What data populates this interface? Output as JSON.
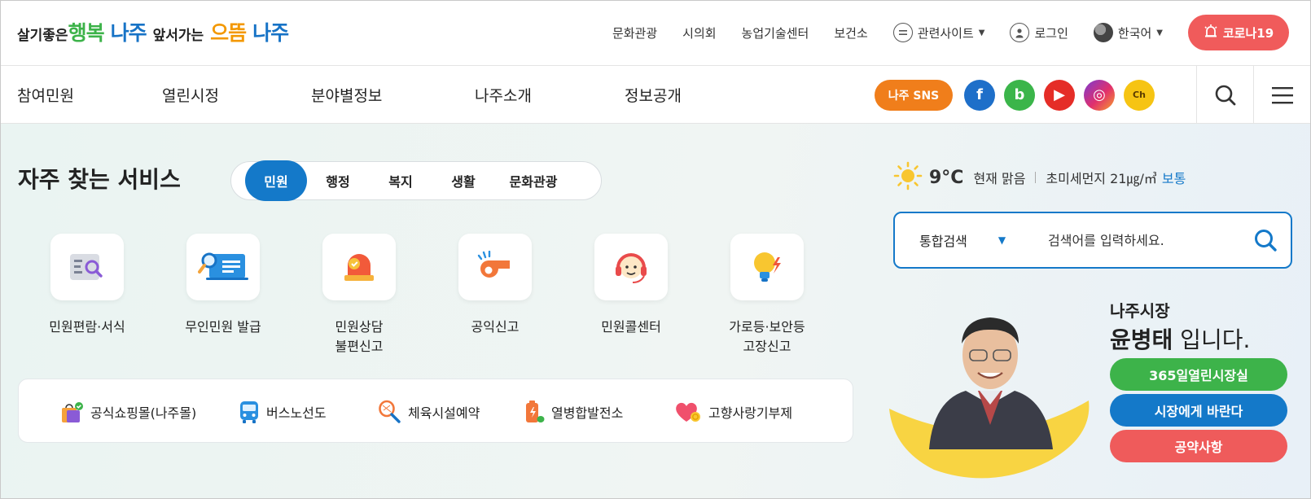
{
  "logo": {
    "part1": "살기좋은",
    "part2": "행복",
    "part3": "나주",
    "part4": "앞서가는",
    "part5": "으뜸",
    "part6": "나주"
  },
  "utility_nav": {
    "links": [
      "문화관광",
      "시의회",
      "농업기술센터",
      "보건소"
    ],
    "related_sites": "관련사이트",
    "login": "로그인",
    "language": "한국어",
    "corona": "코로나19"
  },
  "main_nav": {
    "items": [
      "참여민원",
      "열린시정",
      "분야별정보",
      "나주소개",
      "정보공개"
    ],
    "sns_label": "나주 SNS",
    "sns": [
      {
        "name": "facebook-icon",
        "glyph": "f"
      },
      {
        "name": "blog-icon",
        "glyph": "b"
      },
      {
        "name": "youtube-icon",
        "glyph": "▶"
      },
      {
        "name": "instagram-icon",
        "glyph": "◎"
      },
      {
        "name": "kakao-channel-icon",
        "glyph": "Ch"
      }
    ]
  },
  "services": {
    "title_normal": "자주 찾는",
    "title_bold": "서비스",
    "tabs": [
      "민원",
      "행정",
      "복지",
      "생활",
      "문화관광"
    ],
    "active_tab": "민원",
    "items": [
      {
        "label": "민원편람·서식",
        "label2": ""
      },
      {
        "label": "무인민원 발급",
        "label2": ""
      },
      {
        "label": "민원상담",
        "label2": "불편신고"
      },
      {
        "label": "공익신고",
        "label2": ""
      },
      {
        "label": "민원콜센터",
        "label2": ""
      },
      {
        "label": "가로등·보안등",
        "label2": "고장신고"
      }
    ],
    "quick_links": [
      "공식쇼핑몰(나주몰)",
      "버스노선도",
      "체육시설예약",
      "열병합발전소",
      "고향사랑기부제"
    ]
  },
  "weather": {
    "temperature": "9°C",
    "condition": "현재 맑음",
    "dust_label": "초미세먼지 21㎍/㎥",
    "dust_grade": "보통"
  },
  "search": {
    "scope": "통합검색",
    "placeholder": "검색어를 입력하세요."
  },
  "mayor": {
    "role": "나주시장",
    "name": "윤병태",
    "suffix": " 입니다.",
    "buttons": [
      "365일열린시장실",
      "시장에게 바란다",
      "공약사항"
    ]
  },
  "colors": {
    "primary_blue": "#1479c9",
    "green": "#3db34a",
    "red": "#ef5b5b",
    "orange": "#f07e1b"
  }
}
